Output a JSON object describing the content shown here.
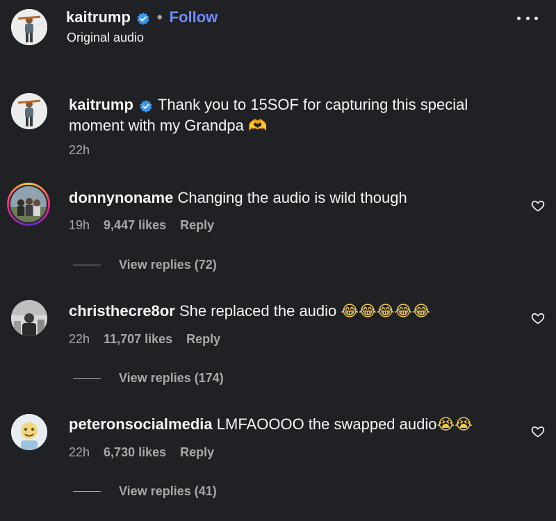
{
  "header": {
    "username": "kaitrump",
    "separator": "•",
    "follow_label": "Follow",
    "subtitle": "Original audio"
  },
  "caption": {
    "username": "kaitrump",
    "text_line1": "Thank you to 15SOF for capturing this special",
    "text_line2": "moment with my Grandpa",
    "emoji": "🫶",
    "time": "22h"
  },
  "comments": [
    {
      "username": "donnynoname",
      "text": "Changing the audio is wild though",
      "emoji": "",
      "time": "19h",
      "likes": "9,447 likes",
      "reply_label": "Reply",
      "view_replies": "View replies (72)"
    },
    {
      "username": "christhecre8or",
      "text": "She replaced the audio",
      "emoji": "😂😂😂😂😂",
      "time": "22h",
      "likes": "11,707 likes",
      "reply_label": "Reply",
      "view_replies": "View replies (174)"
    },
    {
      "username": "peteronsocialmedia",
      "text": "LMFAOOOO the swapped audio",
      "emoji": "😭😭",
      "time": "22h",
      "likes": "6,730 likes",
      "reply_label": "Reply",
      "view_replies": "View replies (41)"
    }
  ],
  "icons": {
    "verified": "verified-badge-icon",
    "more": "more-options-icon",
    "heart": "heart-icon"
  },
  "colors": {
    "background": "#202124",
    "follow": "#6c8cff",
    "verified": "#3897f0",
    "muted": "#a8a8a8"
  }
}
